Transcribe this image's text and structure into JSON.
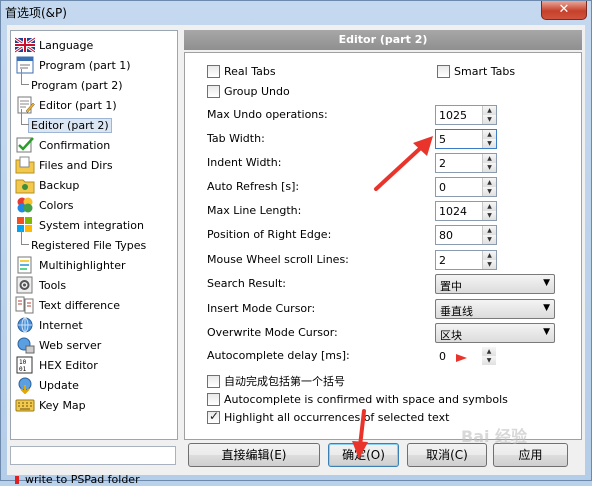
{
  "window": {
    "title": "首选项(&P)",
    "close_label": "✕"
  },
  "sidebar": {
    "items": [
      {
        "label": "Language",
        "icon": "uk-flag-icon"
      },
      {
        "label": "Program  (part 1)",
        "icon": "program-icon"
      },
      {
        "label": "Program  (part 2)",
        "icon": "tree-branch"
      },
      {
        "label": "Editor  (part 1)",
        "icon": "editor-icon"
      },
      {
        "label": "Editor  (part 2)",
        "icon": "tree-branch",
        "selected": true
      },
      {
        "label": "Confirmation",
        "icon": "confirmation-icon"
      },
      {
        "label": "Files and Dirs",
        "icon": "files-icon"
      },
      {
        "label": "Backup",
        "icon": "backup-icon"
      },
      {
        "label": "Colors",
        "icon": "colors-icon"
      },
      {
        "label": "System integration",
        "icon": "system-icon"
      },
      {
        "label": "Registered File Types",
        "icon": "tree-branch"
      },
      {
        "label": "Multihighlighter",
        "icon": "multihighlighter-icon"
      },
      {
        "label": "Tools",
        "icon": "tools-icon"
      },
      {
        "label": "Text difference",
        "icon": "text-difference-icon"
      },
      {
        "label": "Internet",
        "icon": "internet-icon"
      },
      {
        "label": "Web server",
        "icon": "web-server-icon"
      },
      {
        "label": "HEX Editor",
        "icon": "hex-editor-icon"
      },
      {
        "label": "Update",
        "icon": "update-icon"
      },
      {
        "label": "Key Map",
        "icon": "key-map-icon"
      }
    ],
    "search_value": "",
    "write_note": "write to PSPad folder"
  },
  "panel": {
    "title": "Editor  (part 2)",
    "real_tabs": {
      "label": "Real Tabs",
      "checked": false
    },
    "smart_tabs": {
      "label": "Smart Tabs",
      "checked": false
    },
    "group_undo": {
      "label": "Group Undo",
      "checked": false
    },
    "fields": [
      {
        "label": "Max Undo operations:",
        "value": "1025"
      },
      {
        "label": "Tab Width:",
        "value": "5"
      },
      {
        "label": "Indent Width:",
        "value": "2"
      },
      {
        "label": "Auto Refresh [s]:",
        "value": "0"
      },
      {
        "label": "Max Line Length:",
        "value": "1024"
      },
      {
        "label": "Position of Right Edge:",
        "value": "80"
      },
      {
        "label": "Mouse Wheel scroll Lines:",
        "value": "2"
      }
    ],
    "combos": [
      {
        "label": "Search Result:",
        "value": "置中"
      },
      {
        "label": "Insert Mode Cursor:",
        "value": "垂直线"
      },
      {
        "label": "Overwrite Mode Cursor:",
        "value": "区块"
      }
    ],
    "autocomplete_delay": {
      "label": "Autocomplete delay [ms]:",
      "value": "0"
    },
    "auto_bracket": {
      "label": "自动完成包括第一个括号",
      "checked": false
    },
    "autocomplete_space": {
      "label": "Autocomplete is confirmed with space and symbols",
      "checked": false
    },
    "highlight_all": {
      "label": "Highlight all occurrences of selected text",
      "checked": true
    }
  },
  "buttons": {
    "direct_edit": "直接编辑(E)",
    "ok": "确定(O)",
    "cancel": "取消(C)",
    "apply": "应用"
  },
  "watermark": "Bai 经验",
  "colors": {
    "annotation_arrow": "#e8342a",
    "header_bg": "#9a9a9a"
  }
}
